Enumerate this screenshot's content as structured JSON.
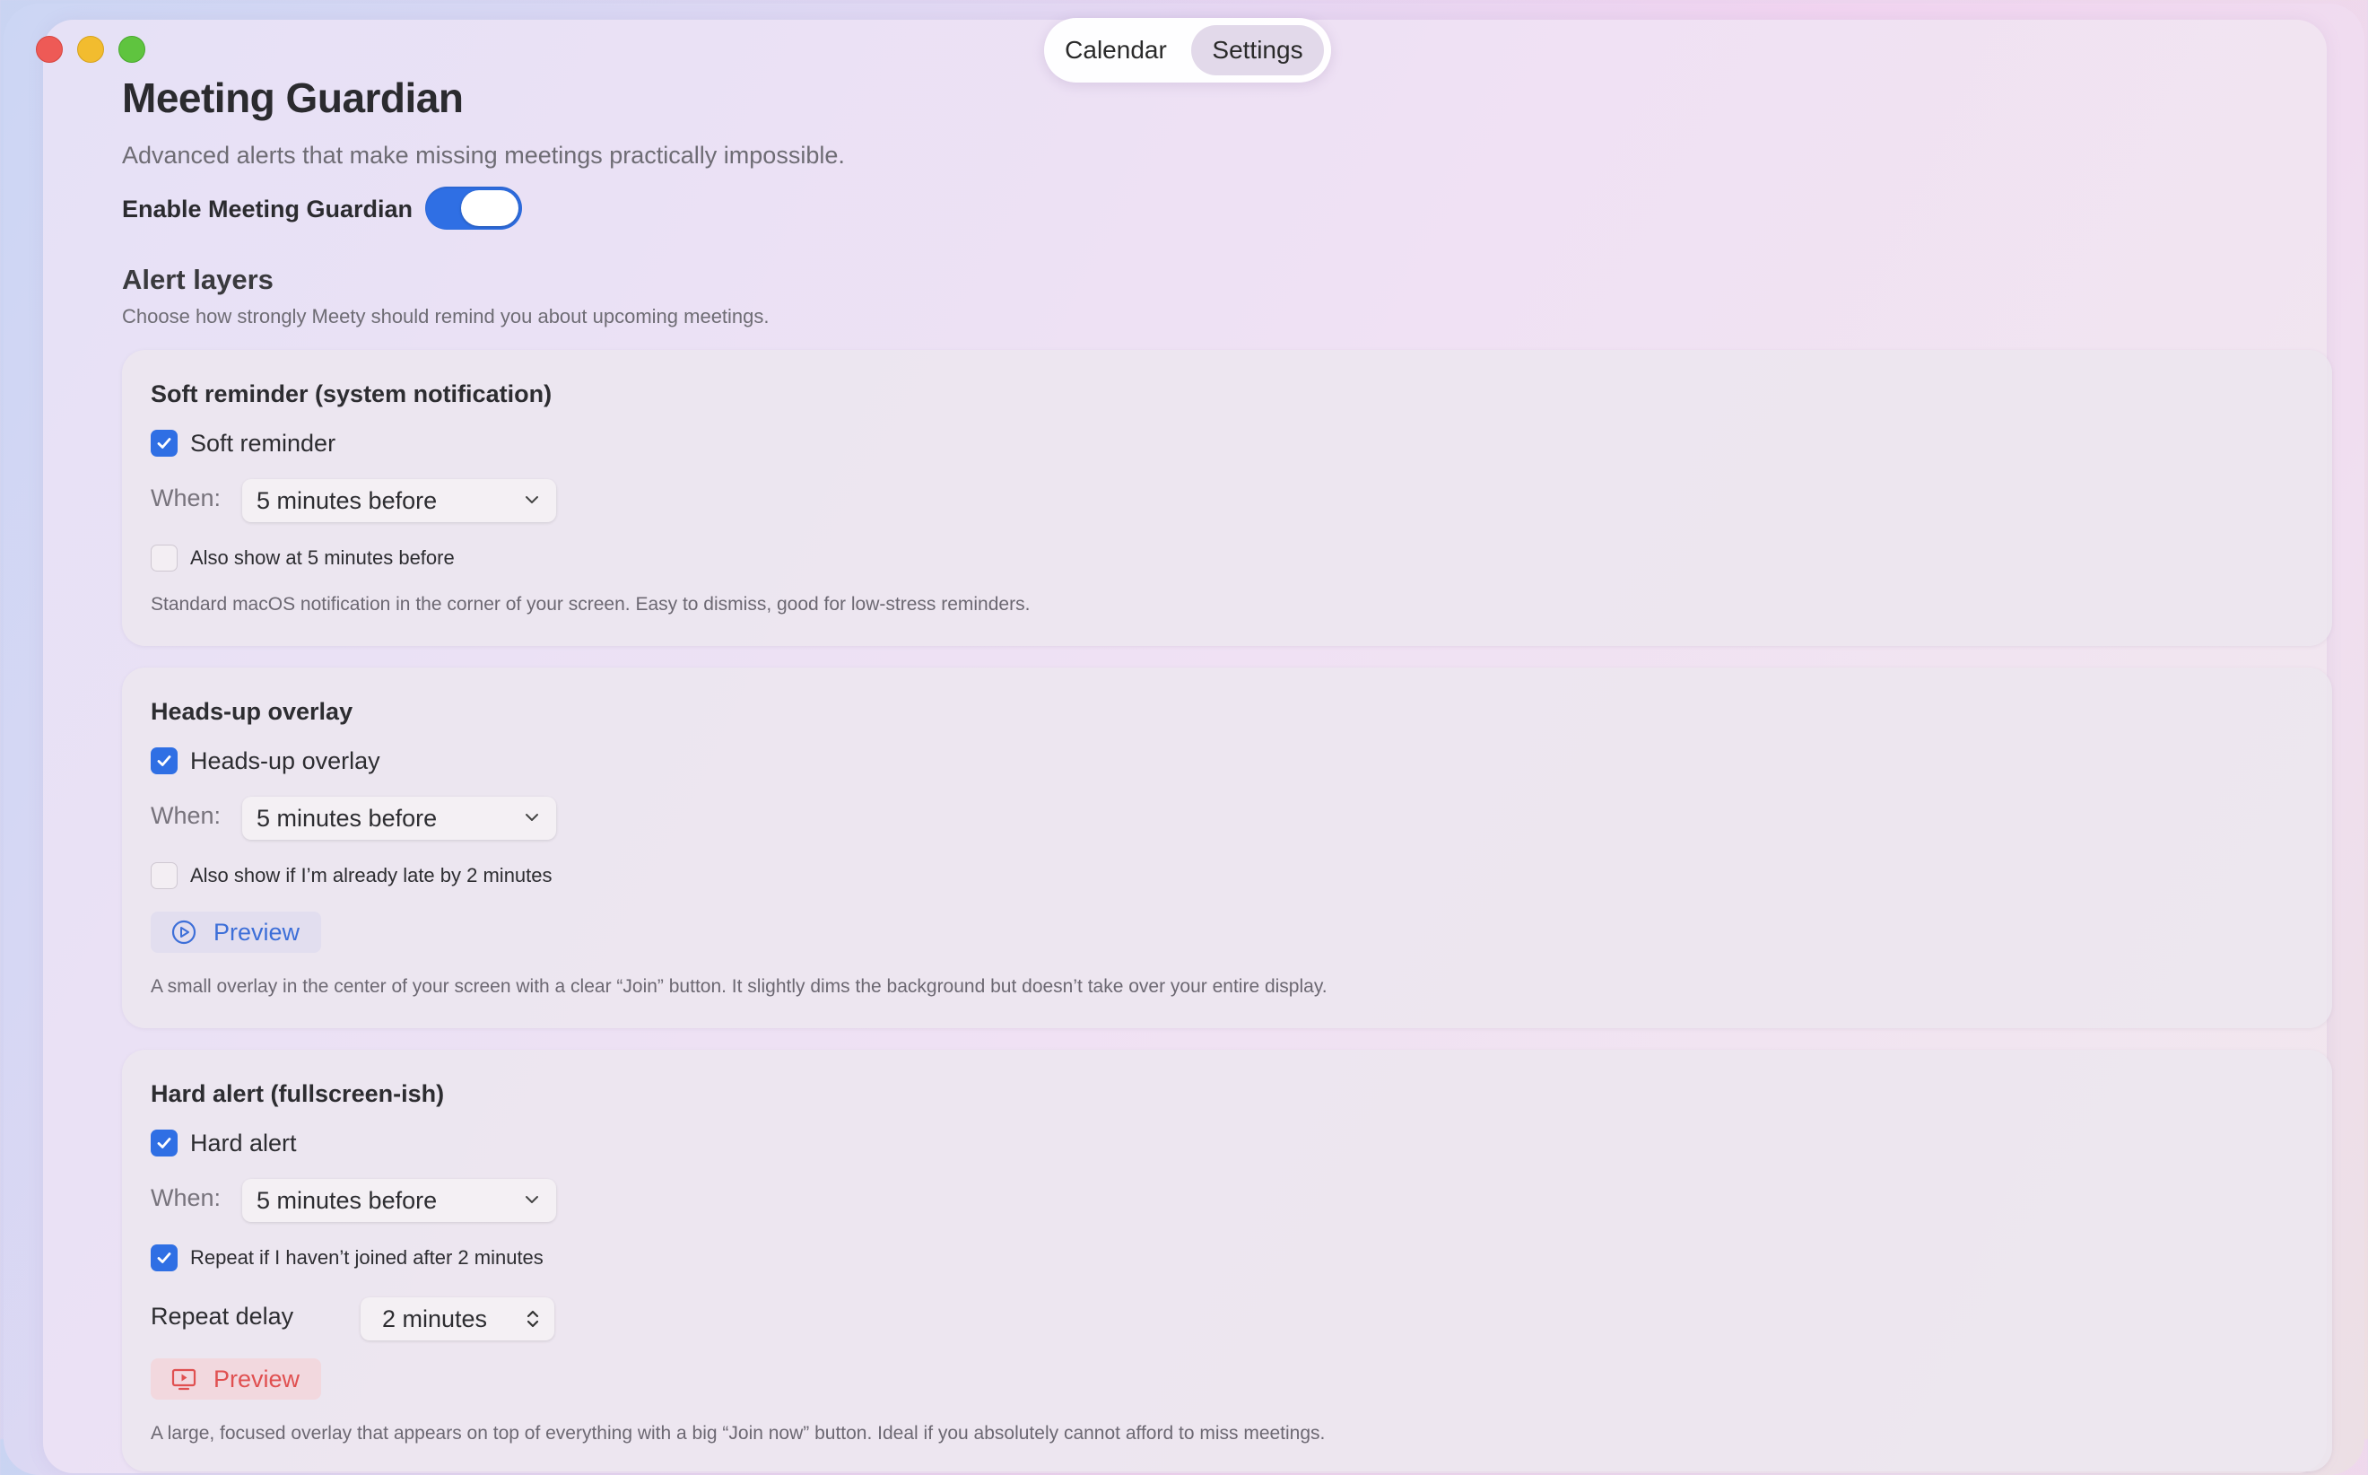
{
  "segmented": {
    "calendar": "Calendar",
    "settings": "Settings",
    "selected": "Settings"
  },
  "header": {
    "title": "Meeting Guardian",
    "subtitle": "Advanced alerts that make missing meetings practically impossible.",
    "enable_label": "Enable Meeting Guardian",
    "enabled": true
  },
  "alert_layers": {
    "title": "Alert layers",
    "description": "Choose how strongly Meety should remind you about upcoming meetings."
  },
  "when_label": "When:",
  "soft": {
    "title": "Soft reminder (system notification)",
    "check_label": "Soft reminder",
    "checked": true,
    "when_value": "5 minutes before",
    "extra_label": "Also show at 5 minutes before",
    "extra_checked": false,
    "description": "Standard macOS notification in the corner of your screen. Easy to dismiss, good for low-stress reminders."
  },
  "headsup": {
    "title": "Heads-up overlay",
    "check_label": "Heads-up overlay",
    "checked": true,
    "when_value": "5 minutes before",
    "extra_label": "Also show if I’m already late by 2 minutes",
    "extra_checked": false,
    "preview_label": "Preview",
    "description": "A small overlay in the center of your screen with a clear “Join” button. It slightly dims the background but doesn’t take over your entire display."
  },
  "hard": {
    "title": "Hard alert (fullscreen-ish)",
    "check_label": "Hard alert",
    "checked": true,
    "when_value": "5 minutes before",
    "repeat_label": "Repeat if I haven’t joined after 2 minutes",
    "repeat_checked": true,
    "repeat_delay_label": "Repeat delay",
    "repeat_delay_value": "2 minutes",
    "preview_label": "Preview",
    "description": "A large, focused overlay that appears on top of everything with a big “Join now” button. Ideal if you absolutely cannot afford to miss meetings."
  },
  "colors": {
    "accent": "#2f6fe4",
    "preview_blue": "#3d6fd8",
    "preview_red": "#e05050"
  }
}
